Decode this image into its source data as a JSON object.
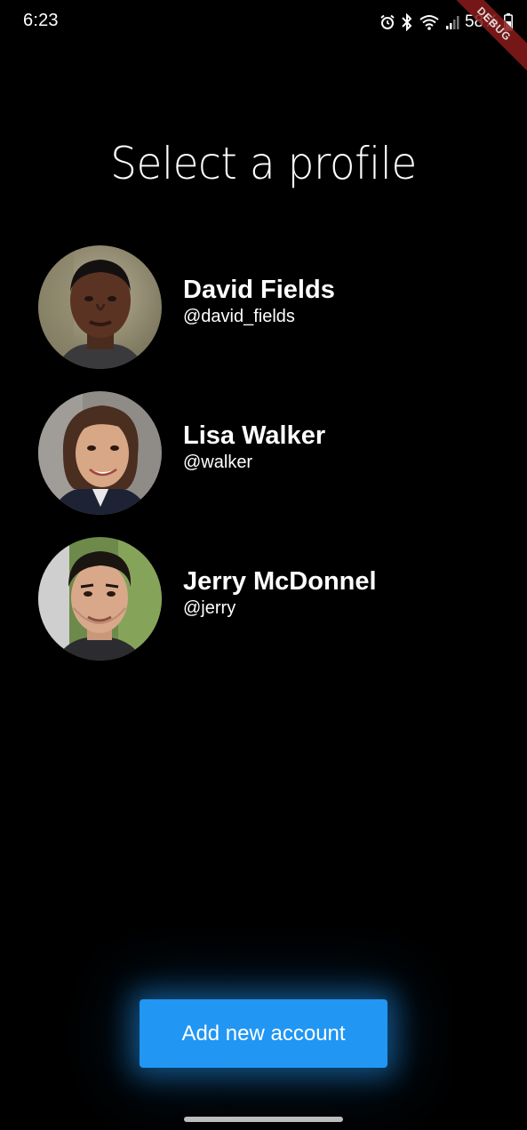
{
  "status_bar": {
    "time": "6:23",
    "battery_percent": "58%",
    "icons": [
      "alarm-icon",
      "bluetooth-icon",
      "wifi-icon",
      "signal-icon",
      "battery-icon"
    ]
  },
  "debug_banner": "DEBUG",
  "title": "Select a profile",
  "profiles": [
    {
      "name": "David Fields",
      "handle": "@david_fields",
      "avatar": "avatar-photo"
    },
    {
      "name": "Lisa Walker",
      "handle": "@walker",
      "avatar": "avatar-photo"
    },
    {
      "name": "Jerry McDonnel",
      "handle": "@jerry",
      "avatar": "avatar-photo"
    }
  ],
  "add_account_label": "Add new account",
  "colors": {
    "background": "#000000",
    "accent": "#2196f3",
    "text": "#ffffff"
  }
}
